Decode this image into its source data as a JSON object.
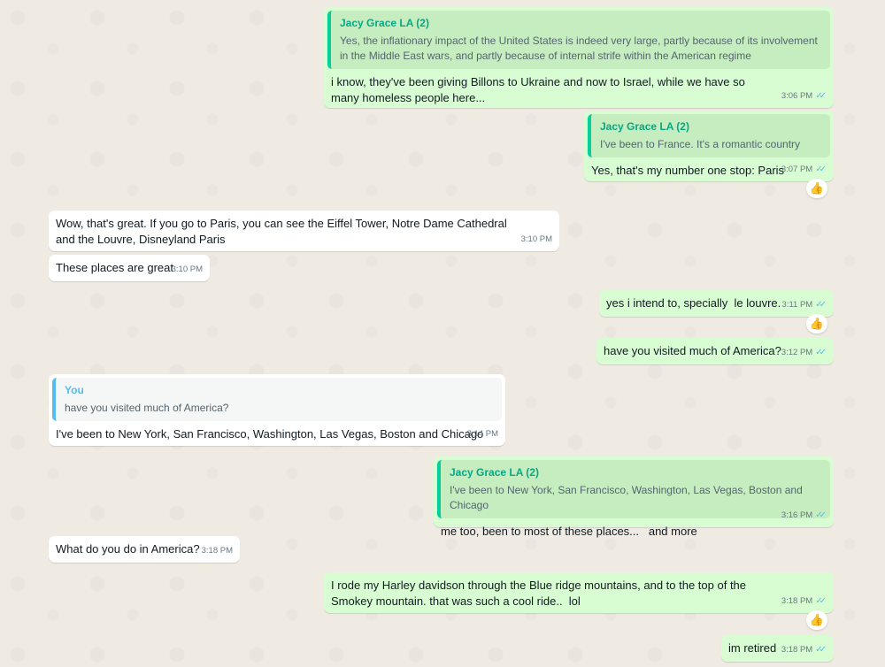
{
  "messages": [
    {
      "quote_author": "Jacy Grace LA (2)",
      "quote_text": "Yes, the inflationary impact of the United States is indeed very large, partly because of its involvement in the Middle East wars, and partly because of internal strife within the American regime",
      "text": "i know, they've been giving Billons to Ukraine and now to Israel, while we have so many homeless people here...",
      "time": "3:06 PM"
    },
    {
      "quote_author": "Jacy Grace LA (2)",
      "quote_text": "I've been to France. It's a romantic country",
      "text": "Yes, that's my number one stop: Paris",
      "time": "3:07 PM"
    },
    {
      "text": "Wow, that's great. If you go to Paris, you can see the Eiffel Tower, Notre Dame Cathedral and the Louvre, Disneyland Paris",
      "time": "3:10 PM"
    },
    {
      "text": "These places are great",
      "time": "3:10 PM"
    },
    {
      "text": "yes i intend to, specially  le louvre.",
      "time": "3:11 PM"
    },
    {
      "text": "have you visited much of America?",
      "time": "3:12 PM"
    },
    {
      "quote_author": "You",
      "quote_text": "have you visited much of America?",
      "text": "I've been to New York, San Francisco, Washington, Las Vegas, Boston and Chicago",
      "time": "3:14 PM"
    },
    {
      "quote_author": "Jacy Grace LA (2)",
      "quote_text": "I've been to New York, San Francisco, Washington, Las Vegas, Boston and Chicago",
      "text": "me too, been to most of these places...   and more",
      "time": "3:16 PM"
    },
    {
      "text": "What do you do in America?",
      "time": "3:18 PM"
    },
    {
      "text": "I rode my Harley davidson through the Blue ridge mountains, and to the top of the Smokey mountain. that was such a cool ride..  lol",
      "time": "3:18 PM"
    },
    {
      "text": "im retired",
      "time": "3:18 PM"
    }
  ],
  "reaction_emoji": "👍",
  "read_ticks": "✓✓",
  "colors": {
    "outgoing": "#d9fdd3",
    "incoming": "#ffffff",
    "background": "#efeae2",
    "tick": "#53bdeb",
    "quote_author": "#06a884"
  }
}
